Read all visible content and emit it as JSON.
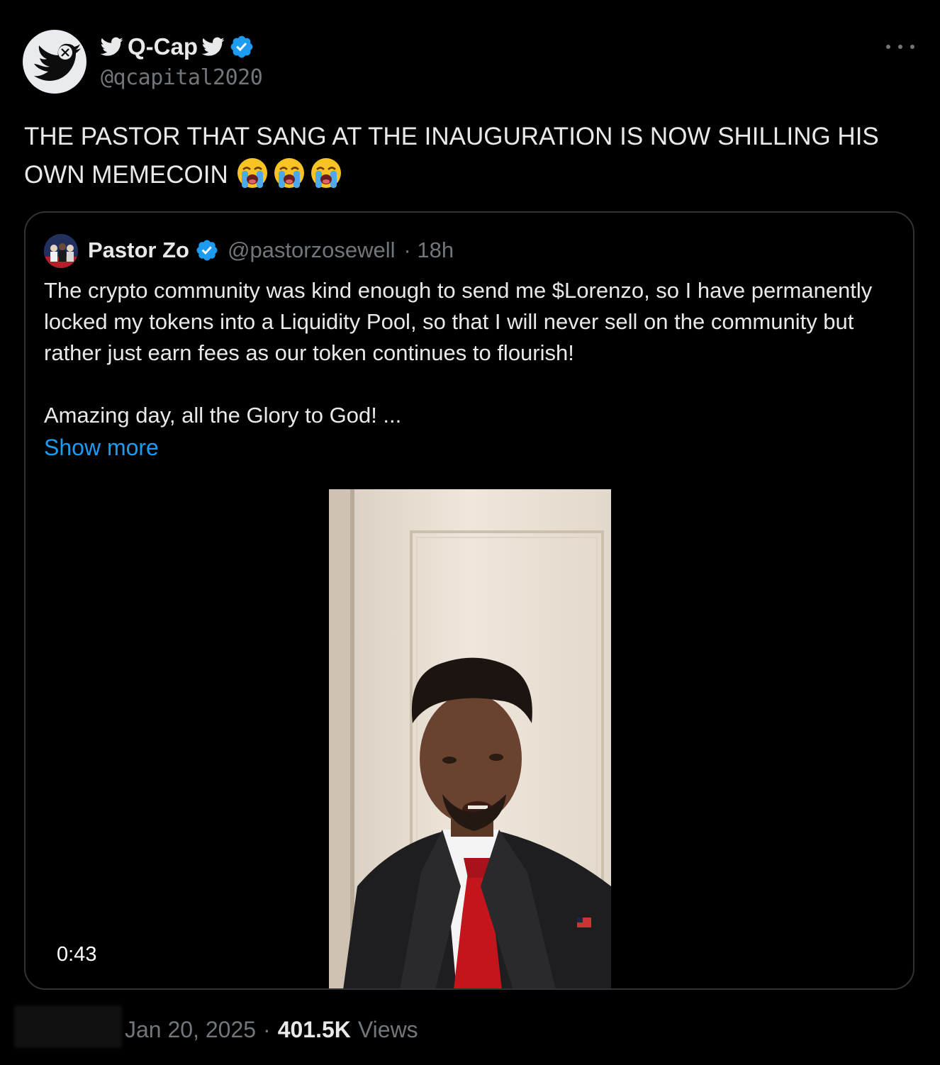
{
  "author": {
    "display_name": "Q-Cap",
    "handle": "@qcapital2020",
    "verified_color": "#1d9bf0",
    "avatar_icon": "twitter-x-bird-icon"
  },
  "tweet": {
    "text": "THE PASTOR THAT SANG AT THE INAUGURATION IS NOW SHILLING HIS OWN MEMECOIN",
    "emoji": [
      "loudly-crying-face",
      "loudly-crying-face",
      "loudly-crying-face"
    ]
  },
  "quote": {
    "name": "Pastor Zo",
    "handle": "@pastorzosewell",
    "time": "· 18h",
    "paragraph1": "The crypto community was kind enough to send me $Lorenzo, so I have permanently locked my tokens into a Liquidity Pool, so that I will never sell on the community but rather just earn fees as our token continues to flourish!",
    "paragraph2": "Amazing day, all the Glory to God! ...",
    "show_more": "Show more",
    "video_duration": "0:43"
  },
  "footer": {
    "date": "Jan 20, 2025",
    "separator": "·",
    "views_count": "401.5K",
    "views_label": "Views"
  },
  "colors": {
    "background": "#000000",
    "text": "#e7e9ea",
    "muted": "#71767b",
    "link": "#1d9bf0",
    "border": "#2f3336"
  }
}
